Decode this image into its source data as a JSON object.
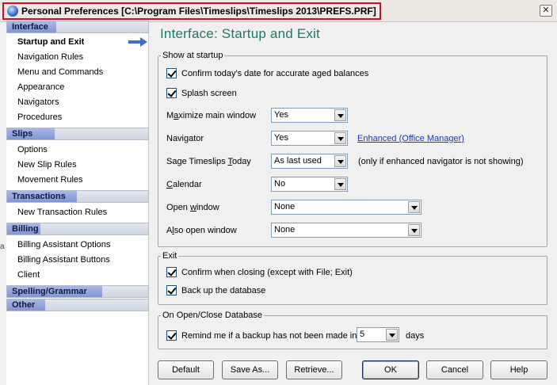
{
  "window": {
    "title": "Personal Preferences [C:\\Program Files\\Timeslips\\Timeslips 2013\\PREFS.PRF]",
    "close_glyph": "✕"
  },
  "sidebar": {
    "sections": [
      {
        "label": "Interface",
        "items": [
          "Startup and Exit",
          "Navigation Rules",
          "Menu and Commands",
          "Appearance",
          "Navigators",
          "Procedures"
        ]
      },
      {
        "label": "Slips",
        "items": [
          "Options",
          "New Slip Rules",
          "Movement Rules"
        ]
      },
      {
        "label": "Transactions",
        "items": [
          "New Transaction Rules"
        ]
      },
      {
        "label": "Billing",
        "items": [
          "Billing Assistant Options",
          "Billing Assistant Buttons",
          "Client"
        ]
      },
      {
        "label": "Spelling/Grammar",
        "items": []
      },
      {
        "label": "Other",
        "items": []
      }
    ],
    "active_item": "Startup and Exit",
    "stub_char": "a"
  },
  "main": {
    "title": "Interface: Startup and Exit",
    "show_at_startup": {
      "label": "Show at startup",
      "confirm_date": {
        "label": "Confirm today's date for accurate aged balances",
        "checked": true
      },
      "splash": {
        "label": "Splash screen",
        "checked": true
      },
      "maximize": {
        "label_pre": "M",
        "label_u": "a",
        "label_post": "ximize main window",
        "value": "Yes"
      },
      "navigator": {
        "label": "Navigator",
        "value": "Yes",
        "link": "Enhanced (Office Manager)"
      },
      "sage_today": {
        "label_pre": "Sage Timeslips ",
        "label_u": "T",
        "label_post": "oday",
        "value": "As last used",
        "note": "(only if enhanced navigator is not showing)"
      },
      "calendar": {
        "label_u": "C",
        "label_post": "alendar",
        "value": "No"
      },
      "open_window": {
        "label_pre": "Open ",
        "label_u": "w",
        "label_post": "indow",
        "value": "None"
      },
      "also_open": {
        "label_pre": "A",
        "label_u": "l",
        "label_post": "so open window",
        "value": "None"
      }
    },
    "exit": {
      "label": "Exit",
      "confirm_closing": {
        "label": "Confirm when closing (except with File; Exit)",
        "checked": true
      },
      "backup": {
        "label": "Back up the database",
        "checked": true
      }
    },
    "open_close": {
      "label": "On Open/Close Database",
      "remind": {
        "label": "Remind me if a backup has not been made in",
        "checked": true,
        "value": "5",
        "unit": "days"
      }
    }
  },
  "buttons": {
    "default": "Default",
    "save_as": "Save As...",
    "retrieve": "Retrieve...",
    "ok": "OK",
    "cancel": "Cancel",
    "help": "Help"
  },
  "colors": {
    "title_accent": "#1f7a6a",
    "link": "#1a35c7",
    "highlight_outline": "#c8102e"
  }
}
